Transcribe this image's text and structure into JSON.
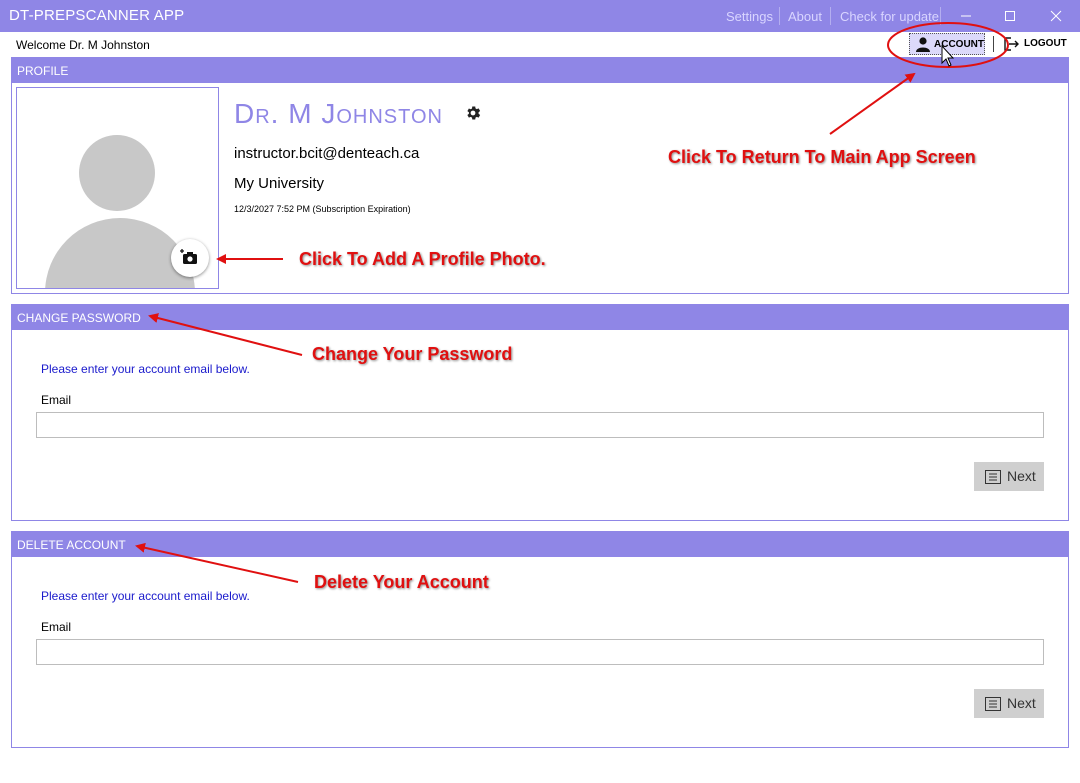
{
  "window": {
    "title": "DT-PREPSCANNER APP",
    "menu": [
      "Settings",
      "About",
      "Check for update"
    ]
  },
  "header": {
    "welcome": "Welcome Dr. M Johnston",
    "account_label": "ACCOUNT",
    "logout_label": "LOGOUT"
  },
  "profile": {
    "section_title": "PROFILE",
    "name": "Dr. M Johnston",
    "email": "instructor.bcit@denteach.ca",
    "university": "My University",
    "expiration": "12/3/2027 7:52 PM (Subscription Expiration)"
  },
  "change_password": {
    "section_title": "CHANGE PASSWORD",
    "instruction": "Please enter your account email below.",
    "email_label": "Email",
    "email_value": "",
    "next_label": "Next"
  },
  "delete_account": {
    "section_title": "DELETE ACCOUNT",
    "instruction": "Please enter your account email below.",
    "email_label": "Email",
    "email_value": "",
    "next_label": "Next"
  },
  "annotations": {
    "return": "Click To Return To Main App Screen",
    "photo": "Click To Add A Profile Photo.",
    "password": "Change Your Password",
    "delete": "Delete Your Account"
  },
  "colors": {
    "accent": "#8f86e6",
    "annotation": "#e01010",
    "link_text": "#1a1acc"
  }
}
